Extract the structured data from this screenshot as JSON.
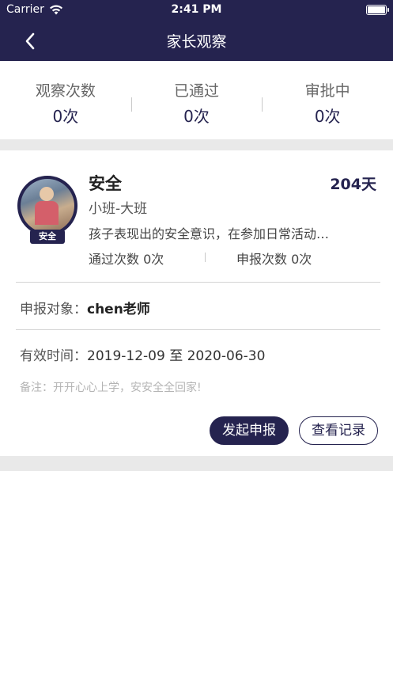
{
  "status_bar": {
    "carrier": "Carrier",
    "time": "2:41 PM",
    "battery_level": 1.0
  },
  "nav": {
    "title": "家长观察",
    "back_icon": "chevron-left-icon"
  },
  "stats": [
    {
      "label": "观察次数",
      "value": "0次"
    },
    {
      "label": "已通过",
      "value": "0次"
    },
    {
      "label": "审批中",
      "value": "0次"
    }
  ],
  "item": {
    "badge_label": "安全",
    "title": "安全",
    "days": "204天",
    "class": "小班-大班",
    "description": "孩子表现出的安全意识，在参加日常活动…",
    "pass_count_label": "通过次数",
    "pass_count_value": "0次",
    "report_count_label": "申报次数",
    "report_count_value": "0次",
    "target_label": "申报对象：",
    "target_value": "chen老师",
    "valid_label": "有效时间：",
    "valid_value": "2019-12-09 至 2020-06-30",
    "note": "备注：开开心心上学，安安全全回家!",
    "primary_button": "发起申报",
    "secondary_button": "查看记录"
  },
  "colors": {
    "brand": "#25234f",
    "separator": "#e9e9e9",
    "note": "#b4b4b4"
  }
}
